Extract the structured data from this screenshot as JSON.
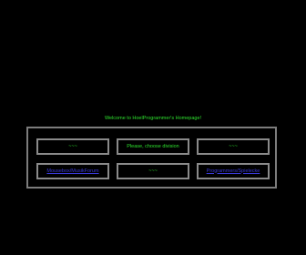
{
  "welcome_text": "Welcome to HoelProgrammer's Homepage!",
  "choice_panel": {
    "top_row": {
      "left": "~~~",
      "center": "Please, choose division",
      "right": "~~~"
    },
    "bottom_row": {
      "left_link": "Mousebox/MusikForum",
      "center": "~~~",
      "right_link": "Programmers/Spielecke"
    }
  },
  "colors": {
    "background": "#000000",
    "text_green": "#2ee22e",
    "link_blue": "#3a3ad8",
    "border_gray": "#8a8a8a"
  }
}
